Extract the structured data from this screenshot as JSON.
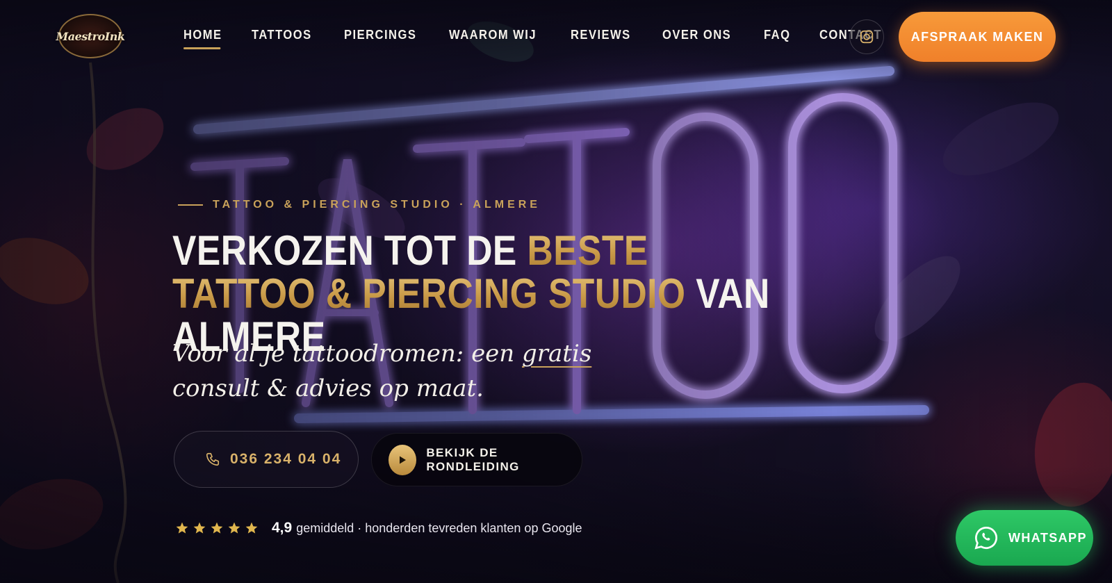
{
  "brand": {
    "logo_text": "MaestroInk"
  },
  "nav": {
    "items": [
      {
        "label": "HOME",
        "active": true
      },
      {
        "label": "TATTOOS",
        "active": false
      },
      {
        "label": "PIERCINGS",
        "active": false
      },
      {
        "label": "WAAROM WIJ",
        "active": false
      },
      {
        "label": "REVIEWS",
        "active": false
      },
      {
        "label": "OVER ONS",
        "active": false
      },
      {
        "label": "FAQ",
        "active": false
      },
      {
        "label": "CONTACT",
        "active": false
      }
    ],
    "instagram_icon": "instagram-icon",
    "cta_label": "AFSPRAAK MAKEN"
  },
  "hero": {
    "eyebrow": "TATTOO & PIERCING STUDIO · ALMERE",
    "headline": {
      "part1": "VERKOZEN TOT DE ",
      "part2_gold": "BESTE TATTOO & PIERCING STUDIO",
      "part3": " VAN ALMERE"
    },
    "subtitle": {
      "before": "Voor al je tattoodromen: een ",
      "underlined": "gratis",
      "after": " consult & advies op maat."
    },
    "phone": {
      "label": "036 234 04 04",
      "icon": "phone-icon"
    },
    "tour": {
      "label": "BEKIJK DE RONDLEIDING",
      "icon": "play-icon"
    },
    "rating": {
      "stars": 5,
      "value": "4,9",
      "text": "gemiddeld · honderden tevreden klanten op Google"
    }
  },
  "whatsapp": {
    "label": "WHATSAPP",
    "icon": "whatsapp-icon"
  },
  "colors": {
    "gold": "#c9a25a",
    "cta_orange": "#f08a30",
    "whatsapp_green": "#22b85a",
    "neon_purple": "#b48cff",
    "neon_blue": "#9fa8ff"
  }
}
